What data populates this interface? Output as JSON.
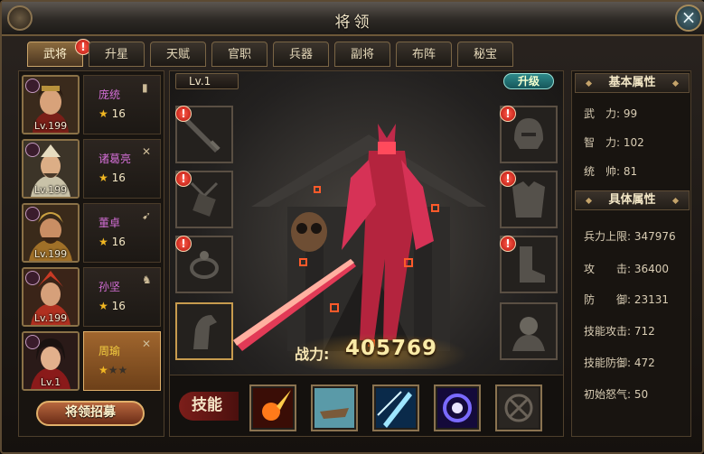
{
  "window": {
    "title": "将领",
    "close_label": "×"
  },
  "tabs": [
    {
      "label": "武将",
      "active": true,
      "badge": "!"
    },
    {
      "label": "升星"
    },
    {
      "label": "天赋"
    },
    {
      "label": "官职"
    },
    {
      "label": "兵器"
    },
    {
      "label": "副将"
    },
    {
      "label": "布阵"
    },
    {
      "label": "秘宝"
    }
  ],
  "heroes": [
    {
      "name": "庞统",
      "level": "Lv.199",
      "stars": "16",
      "badge_icon": "shield-icon"
    },
    {
      "name": "诸葛亮",
      "level": "Lv.199",
      "stars": "16",
      "badge_icon": "bow-icon"
    },
    {
      "name": "董卓",
      "level": "Lv.199",
      "stars": "16",
      "badge_icon": "spear-icon"
    },
    {
      "name": "孙坚",
      "level": "Lv.199",
      "stars": "16",
      "badge_icon": "horse-icon"
    },
    {
      "name": "周瑜",
      "level": "Lv.1",
      "star_rating": 1,
      "star_max": 3,
      "badge_icon": "bow-icon",
      "selected": true
    }
  ],
  "recruit_label": "将领招募",
  "center": {
    "level": "Lv.1",
    "upgrade_label": "升级",
    "power_label": "战力:",
    "power_value": "405769",
    "skill_label": "技能",
    "left_slots": [
      "weapon-slot",
      "amulet-slot",
      "ring-slot",
      "horse-slot"
    ],
    "right_slots": [
      "helmet-slot",
      "armor-slot",
      "boots-slot",
      "aide-slot"
    ],
    "skills": [
      "meteor-skill-icon",
      "boat-skill-icon",
      "ice-blade-skill-icon",
      "vortex-skill-icon",
      "locked-skill-icon"
    ]
  },
  "basic_attrs": {
    "title": "基本属性",
    "items": [
      "武　力: 99",
      "智　力: 102",
      "统　帅: 81"
    ]
  },
  "detail_attrs": {
    "title": "具体属性",
    "items": [
      "兵力上限: 347976",
      "攻　　击: 36400",
      "防　　御: 23131",
      "技能攻击: 712",
      "技能防御: 472",
      "初始怒气: 50"
    ]
  },
  "colors": {
    "accent_gold": "#e1b06a",
    "name_purple": "#d36ed6",
    "name_gold": "#f5d040",
    "badge_red": "#d8261a"
  }
}
